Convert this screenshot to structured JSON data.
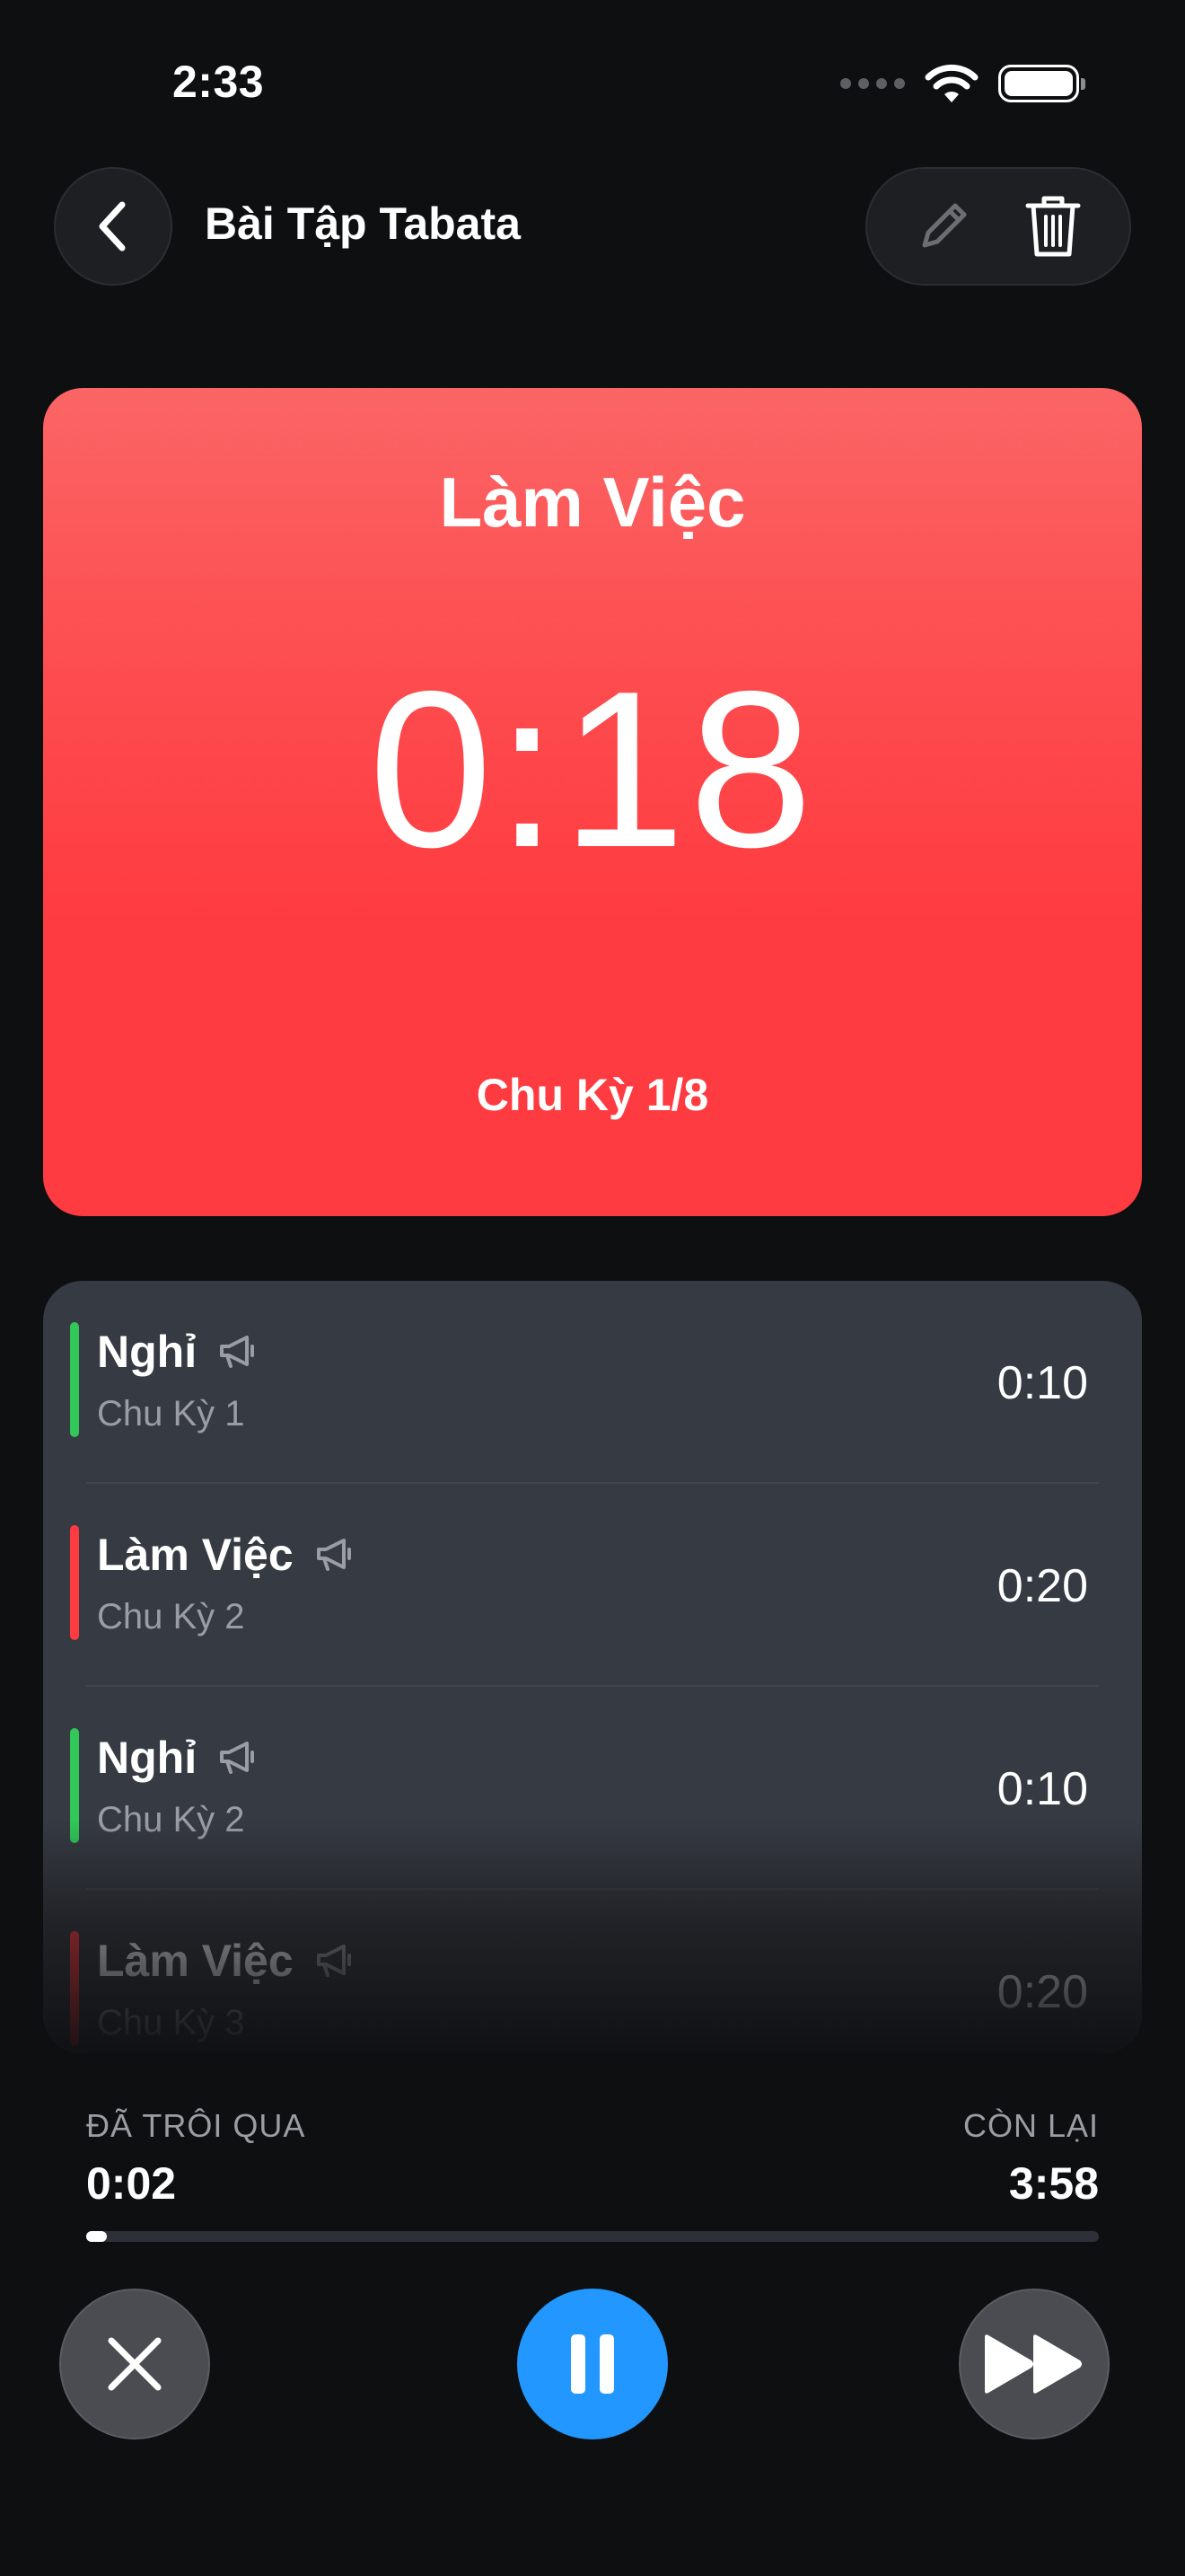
{
  "status_bar": {
    "time": "2:33"
  },
  "header": {
    "title": "Bài Tập Tabata"
  },
  "timer": {
    "phase": "Làm Việc",
    "time": "0:18",
    "cycle": "Chu Kỳ 1/8",
    "color_top": "#fb6565",
    "color_bottom": "#fe3b40"
  },
  "intervals": [
    {
      "name": "Nghỉ",
      "cycle": "Chu Kỳ 1",
      "duration": "0:10",
      "color": "#31c759",
      "icon": "megaphone-icon"
    },
    {
      "name": "Làm Việc",
      "cycle": "Chu Kỳ 2",
      "duration": "0:20",
      "color": "#fe3b40",
      "icon": "megaphone-icon"
    },
    {
      "name": "Nghỉ",
      "cycle": "Chu Kỳ 2",
      "duration": "0:10",
      "color": "#31c759",
      "icon": "megaphone-icon"
    },
    {
      "name": "Làm Việc",
      "cycle": "Chu Kỳ 3",
      "duration": "0:20",
      "color": "#fe3b40",
      "icon": "megaphone-icon"
    }
  ],
  "progress": {
    "elapsed_label": "ĐÃ TRÔI QUA",
    "elapsed": "0:02",
    "remaining_label": "CÒN LẠI",
    "remaining": "3:58",
    "fraction": 0.0083
  },
  "controls": {
    "close_icon": "close-icon",
    "pause_icon": "pause-icon",
    "skip_icon": "skip-forward-icon",
    "accent": "#2197ff"
  }
}
